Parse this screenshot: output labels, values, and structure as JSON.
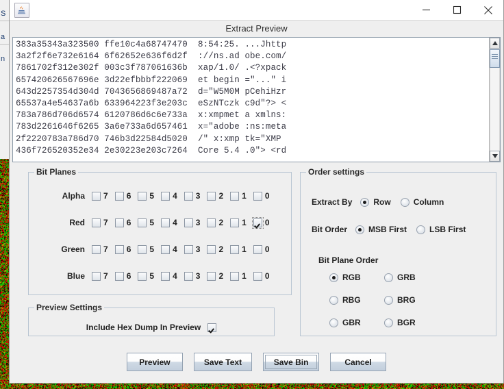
{
  "window": {
    "app_icon": "java-coffee-cup-icon",
    "minimize_label": "minimize-icon",
    "maximize_label": "maximize-icon",
    "close_label": "close-icon",
    "dialog_title": "Extract Preview"
  },
  "behind_window": {
    "fragment_a": "S",
    "fragment_b": "a",
    "fragment_c": "n"
  },
  "hexdump": {
    "lines": [
      "383a35343a323500 ffe10c4a68747470  8:54:25. ...Jhttp",
      "3a2f2f6e732e6164 6f62652e636f6d2f  ://ns.ad obe.com/",
      "7861702f312e302f 003c3f787061636b  xap/1.0/ .<?xpack",
      "657420626567696e 3d22efbbbf222069  et begin =\"...\" i",
      "643d2257354d304d 7043656869487a72  d=\"W5M0M pCehiHzr",
      "65537a4e54637a6b 633964223f3e203c  eSzNTczk c9d\"?> <",
      "783a786d706d6574 6120786d6c6e733a  x:xmpmet a xmlns:",
      "783d2261646f6265 3a6e733a6d657461  x=\"adobe :ns:meta",
      "2f2220783a786d70 746b3d22584d5020  /\" x:xmp tk=\"XMP",
      "436f726520352e34 2e30223e203c7264  Core 5.4 .0\"> <rd"
    ],
    "scrollbar": {
      "up_arrow": "scroll-up-icon",
      "down_arrow": "scroll-down-icon"
    }
  },
  "bit_planes": {
    "legend": "Bit Planes",
    "bit_labels": [
      "7",
      "6",
      "5",
      "4",
      "3",
      "2",
      "1",
      "0"
    ],
    "channels": [
      {
        "name": "Alpha",
        "checked": [
          false,
          false,
          false,
          false,
          false,
          false,
          false,
          false
        ]
      },
      {
        "name": "Red",
        "checked": [
          false,
          false,
          false,
          false,
          false,
          false,
          false,
          true
        ]
      },
      {
        "name": "Green",
        "checked": [
          false,
          false,
          false,
          false,
          false,
          false,
          false,
          false
        ]
      },
      {
        "name": "Blue",
        "checked": [
          false,
          false,
          false,
          false,
          false,
          false,
          false,
          false
        ]
      }
    ],
    "focused_channel": 1,
    "focused_bit": 7
  },
  "order_settings": {
    "legend": "Order settings",
    "extract_by": {
      "label": "Extract By",
      "options": [
        "Row",
        "Column"
      ],
      "selected": "Row"
    },
    "bit_order": {
      "label": "Bit Order",
      "options": [
        "MSB First",
        "LSB First"
      ],
      "selected": "MSB First"
    },
    "bit_plane_order": {
      "label": "Bit Plane Order",
      "options": [
        "RGB",
        "GRB",
        "RBG",
        "BRG",
        "GBR",
        "BGR"
      ],
      "selected": "RGB"
    }
  },
  "preview_settings": {
    "legend": "Preview Settings",
    "include_hex_dump": {
      "label": "Include Hex Dump In Preview",
      "checked": true
    }
  },
  "buttons": [
    {
      "label": "Preview",
      "focused": false
    },
    {
      "label": "Save Text",
      "focused": false
    },
    {
      "label": "Save Bin",
      "focused": true
    },
    {
      "label": "Cancel",
      "focused": false
    }
  ],
  "colors": {
    "dialog_bg": "#efefef",
    "panel_border": "#b7c4d2",
    "noise_red": "#d40000",
    "noise_green": "#00cc00",
    "noise_black": "#000000"
  }
}
